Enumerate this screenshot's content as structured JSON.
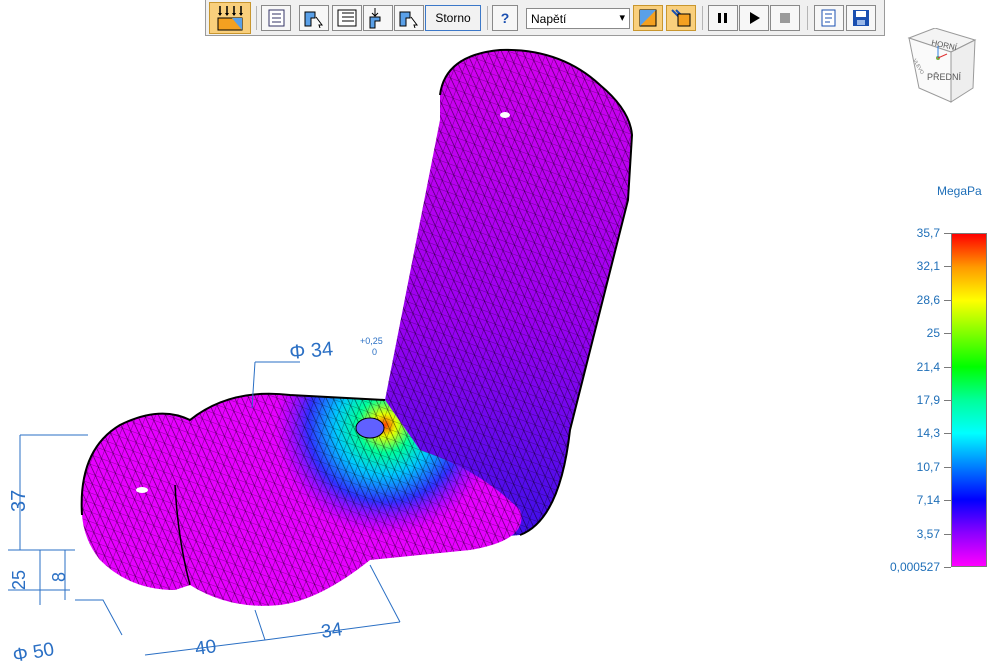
{
  "toolbar": {
    "storno_label": "Storno",
    "help_label": "?",
    "stress_select": {
      "selected": "Napětí"
    },
    "icons": [
      "load-arrows-icon",
      "results-list-icon",
      "probe-icon",
      "table-icon",
      "fixed-constraint-icon",
      "probe-cursor-icon",
      "help-icon",
      "contour-shaded-icon",
      "contour-edges-icon",
      "pause-icon",
      "play-icon",
      "stop-icon",
      "report-icon",
      "save-icon"
    ]
  },
  "view_cube": {
    "top_label": "HORNÍ",
    "front_label": "PŘEDNÍ",
    "side_label": "VLEVO"
  },
  "legend": {
    "unit": "MegaPa",
    "values": [
      "35,7",
      "32,1",
      "28,6",
      "25",
      "21,4",
      "17,9",
      "14,3",
      "10,7",
      "7,14",
      "3,57",
      "0,000527"
    ],
    "colors": {
      "max": "#ff0000",
      "mid": "#00ff00",
      "min": "#ff00ff"
    }
  },
  "dimensions": {
    "hole_diameter": "Φ 34",
    "hole_tolerance_upper": "+0,25",
    "hole_tolerance_lower": "0",
    "height": "37",
    "d25": "25",
    "d8": "8",
    "boss_diameter": "Φ 50",
    "d40": "40",
    "d34": "34"
  }
}
